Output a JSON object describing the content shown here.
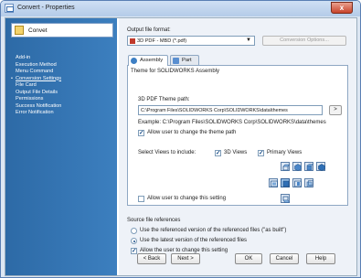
{
  "window": {
    "title": "Convert - Properties",
    "close_glyph": "x"
  },
  "left_panel": {
    "header": "Convet",
    "nav": [
      {
        "label": "Add-in",
        "active": false
      },
      {
        "label": "Execution Method",
        "active": false
      },
      {
        "label": "Menu Command",
        "active": false
      },
      {
        "label": "Conversion Settings",
        "active": true
      },
      {
        "label": "File Card",
        "active": false
      },
      {
        "label": "Output File Details",
        "active": false
      },
      {
        "label": "Permissions",
        "active": false
      },
      {
        "label": "Success Notification",
        "active": false
      },
      {
        "label": "Error Notification",
        "active": false
      }
    ]
  },
  "output_format": {
    "label": "Output file format:",
    "selected": "3D PDF - MBD (*.pdf)",
    "conversion_options": "Conversion Options..."
  },
  "tabs": [
    {
      "label": "Assembly"
    },
    {
      "label": "Part"
    }
  ],
  "theme": {
    "group_title": "Theme for SOLIDWORKS Assembly",
    "path_label": "3D PDF Theme path:",
    "path_value": "C:\\Program Files\\SOLIDWORKS Corp\\SOLIDWORKS\\data\\themes",
    "browse": ">",
    "example": "Example: C:\\Program Files\\SOLIDWORKS Corp\\SOLIDWORKS\\data\\themes",
    "allow_change_path": "Allow user to change the theme path"
  },
  "views": {
    "label": "Select Views to include:",
    "views_3d": "3D Views",
    "primary_views": "Primary Views",
    "allow_change": "Allow user to change this setting"
  },
  "source_refs": {
    "title": "Source file references",
    "option_as_built": "Use the referenced version of the referenced files (\"as built\")",
    "option_latest": "Use the latest version of the referenced files",
    "allow_change": "Allow the user to change this setting"
  },
  "footer": {
    "back": "< Back",
    "next": "Next >",
    "ok": "OK",
    "cancel": "Cancel",
    "help": "Help"
  }
}
